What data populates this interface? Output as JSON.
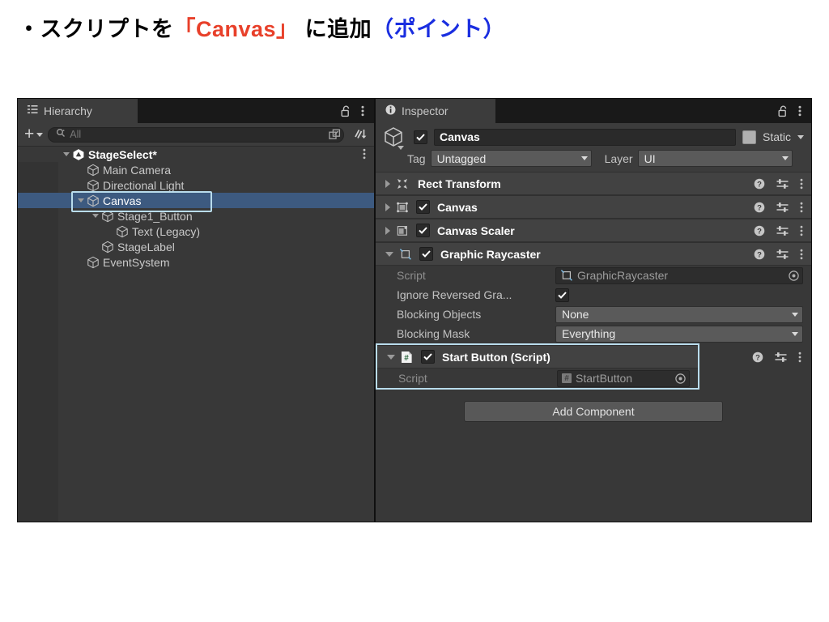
{
  "slide": {
    "title_parts": [
      {
        "text": "・スクリプトを",
        "color": "black"
      },
      {
        "text": "「Canvas」",
        "color": "red"
      },
      {
        "text": " に追加",
        "color": "black"
      },
      {
        "text": "（ポイント）",
        "color": "blue"
      }
    ],
    "accent_red": "#e8402a",
    "accent_blue": "#1a2ee0",
    "highlight_color": "#b9dcec"
  },
  "hierarchy": {
    "tab_label": "Hierarchy",
    "tab_icon": "hierarchy-list-icon",
    "lock_icon": "unlocked-padlock-icon",
    "menu_icon": "kebab-menu-icon",
    "toolbar": {
      "add_label": "+",
      "search_placeholder": "All",
      "search_value": "",
      "search_icon": "magnifier-icon",
      "expand_icon": "open-in-window-icon",
      "sort_icon": "sort-descending-icon"
    },
    "items": [
      {
        "label": "StageSelect*",
        "depth": 0,
        "foldout": "open",
        "selected": false,
        "root": true,
        "icon": "unity-scene-icon",
        "kebab": true
      },
      {
        "label": "Main Camera",
        "depth": 1,
        "foldout": "none",
        "selected": false,
        "root": false,
        "icon": "gameobject-cube-icon",
        "kebab": false
      },
      {
        "label": "Directional Light",
        "depth": 1,
        "foldout": "none",
        "selected": false,
        "root": false,
        "icon": "gameobject-cube-icon",
        "kebab": false
      },
      {
        "label": "Canvas",
        "depth": 1,
        "foldout": "open",
        "selected": true,
        "root": false,
        "icon": "gameobject-cube-icon",
        "kebab": false
      },
      {
        "label": "Stage1_Button",
        "depth": 2,
        "foldout": "open",
        "selected": false,
        "root": false,
        "icon": "gameobject-cube-icon",
        "kebab": false
      },
      {
        "label": "Text (Legacy)",
        "depth": 3,
        "foldout": "none",
        "selected": false,
        "root": false,
        "icon": "gameobject-cube-icon",
        "kebab": false
      },
      {
        "label": "StageLabel",
        "depth": 2,
        "foldout": "none",
        "selected": false,
        "root": false,
        "icon": "gameobject-cube-icon",
        "kebab": false
      },
      {
        "label": "EventSystem",
        "depth": 1,
        "foldout": "none",
        "selected": false,
        "root": false,
        "icon": "gameobject-cube-icon",
        "kebab": false
      }
    ]
  },
  "inspector": {
    "tab_label": "Inspector",
    "tab_icon": "info-circle-icon",
    "lock_icon": "unlocked-padlock-icon",
    "menu_icon": "kebab-menu-icon",
    "gameobject": {
      "icon": "gameobject-cube-icon",
      "enabled": true,
      "name": "Canvas",
      "static_label": "Static",
      "static_checked": false,
      "tag_label": "Tag",
      "tag_value": "Untagged",
      "layer_label": "Layer",
      "layer_value": "UI"
    },
    "components": [
      {
        "title": "Rect Transform",
        "icon": "rect-transform-icon",
        "has_checkbox": false,
        "checked": false,
        "expanded": false,
        "highlighted": false,
        "properties": []
      },
      {
        "title": "Canvas",
        "icon": "canvas-icon",
        "has_checkbox": true,
        "checked": true,
        "expanded": false,
        "highlighted": false,
        "properties": []
      },
      {
        "title": "Canvas Scaler",
        "icon": "canvas-scaler-icon",
        "has_checkbox": true,
        "checked": true,
        "expanded": false,
        "highlighted": false,
        "properties": []
      },
      {
        "title": "Graphic Raycaster",
        "icon": "graphic-raycaster-icon",
        "has_checkbox": true,
        "checked": true,
        "expanded": true,
        "highlighted": false,
        "properties": [
          {
            "label": "Script",
            "dim": true,
            "type": "object",
            "value": "GraphicRaycaster",
            "value_icon": "graphic-raycaster-icon"
          },
          {
            "label": "Ignore Reversed Gra...",
            "dim": false,
            "type": "checkbox",
            "value": "",
            "checked": true
          },
          {
            "label": "Blocking Objects",
            "dim": false,
            "type": "dropdown",
            "value": "None"
          },
          {
            "label": "Blocking Mask",
            "dim": false,
            "type": "dropdown",
            "value": "Everything"
          }
        ]
      },
      {
        "title": "Start Button (Script)",
        "icon": "csharp-script-icon",
        "has_checkbox": true,
        "checked": true,
        "expanded": true,
        "highlighted": true,
        "properties": [
          {
            "label": "Script",
            "dim": true,
            "type": "object",
            "value": "StartButton",
            "value_icon": "csharp-script-icon"
          }
        ]
      }
    ],
    "help_icon": "help-question-icon",
    "preset_icon": "preset-sliders-icon",
    "component_menu_icon": "kebab-menu-icon",
    "add_component_label": "Add Component"
  }
}
